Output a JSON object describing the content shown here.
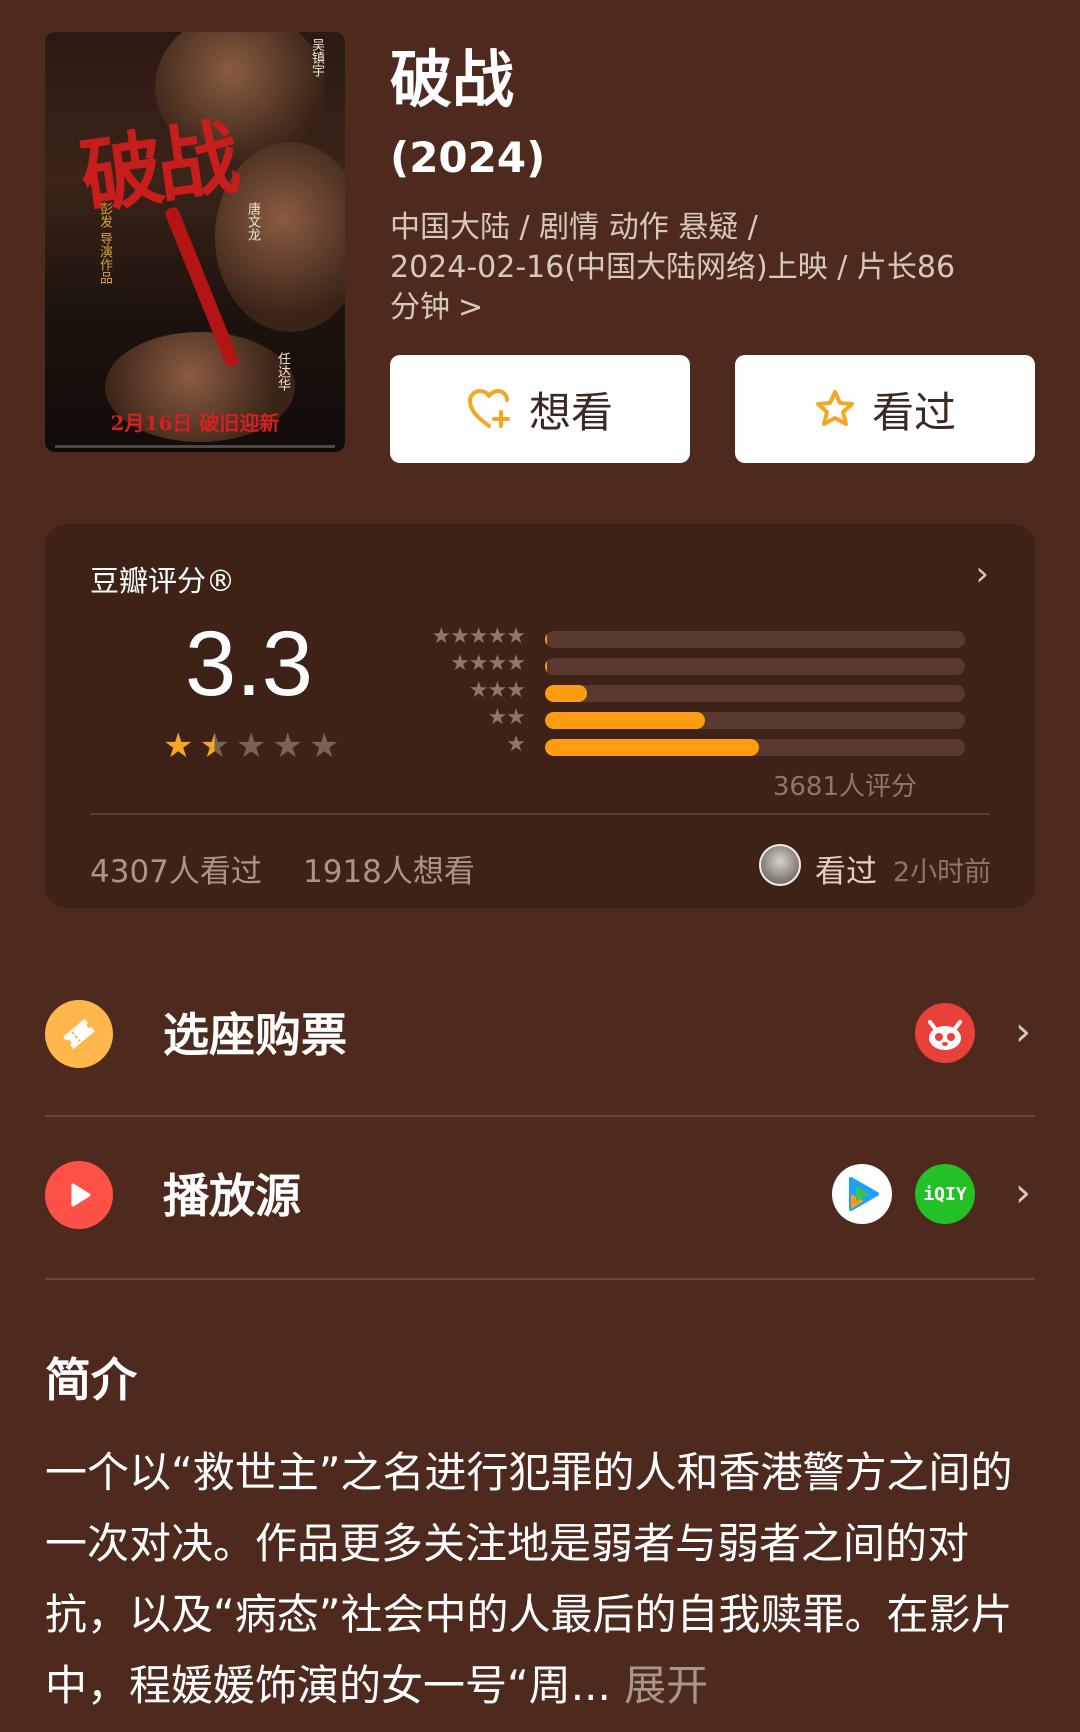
{
  "movie": {
    "title": "破战",
    "year": "(2024)",
    "meta_line1": "中国大陆 / 剧情 动作 悬疑 /",
    "meta_line2": "2024-02-16(中国大陆网络)上映 / 片长86",
    "meta_line3": "分钟",
    "meta_chevron": ">"
  },
  "poster": {
    "title_art": "破战",
    "cast_1": "吴镇宇",
    "cast_2": "唐文龙",
    "cast_3": "任达华",
    "director_credit": "彭发 导演作品",
    "release_text": "2月16日 破旧迎新"
  },
  "actions": {
    "want_label": "想看",
    "seen_label": "看过"
  },
  "rating": {
    "title": "豆瓣评分®",
    "score": "3.3",
    "star_level": 1.5,
    "count": "3681人评分",
    "distribution": [
      {
        "stars": "★★★★★",
        "percent": 0.5
      },
      {
        "stars": "★★★★",
        "percent": 0.4
      },
      {
        "stars": "★★★",
        "percent": 10
      },
      {
        "stars": "★★",
        "percent": 38
      },
      {
        "stars": "★",
        "percent": 51
      }
    ],
    "watched": "4307人看过",
    "wish": "1918人想看",
    "friend_status": "看过",
    "friend_time": "2小时前"
  },
  "rows": {
    "ticket_label": "选座购票",
    "play_label": "播放源",
    "iqiyi_text": "iQIY"
  },
  "intro": {
    "title": "简介",
    "text": "一个以“救世主”之名进行犯罪的人和香港警方之间的一次对决。作品更多关注地是弱者与弱者之间的对抗，以及“病态”社会中的人最后的自我赎罪。在影片中，程媛媛饰演的女一号“周...",
    "expand": "展开"
  },
  "colors": {
    "background": "#4e2a1e",
    "card": "#3e2117",
    "accent_orange": "#ff9c12",
    "star_gold": "#f5a623"
  }
}
